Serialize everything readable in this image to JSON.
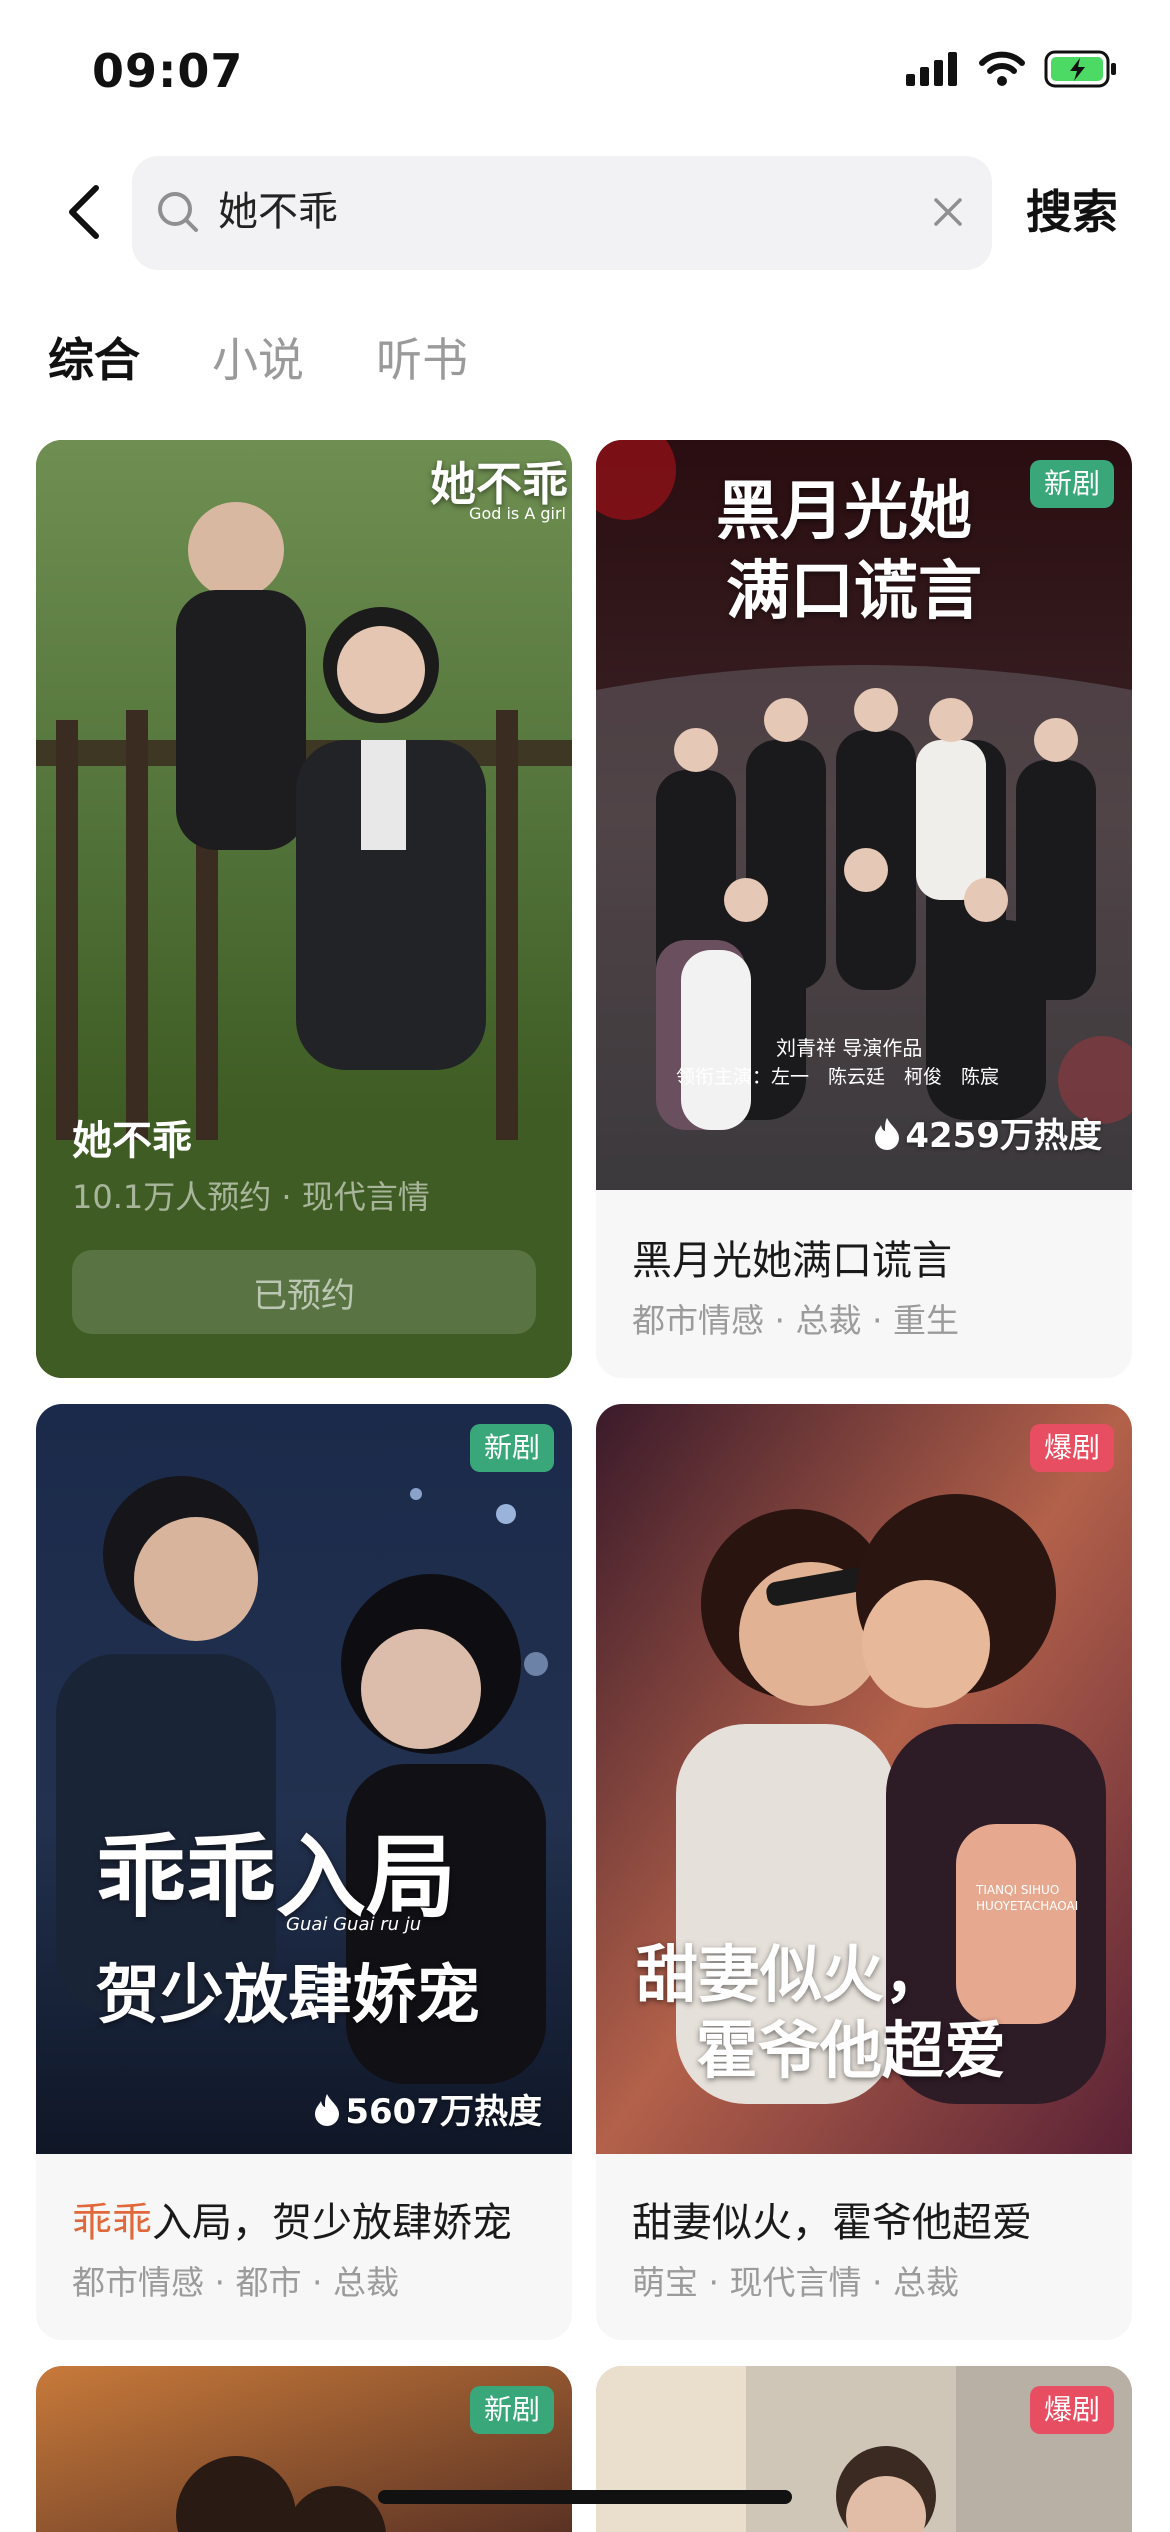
{
  "status_bar": {
    "time": "09:07"
  },
  "search": {
    "query": "她不乖",
    "button_label": "搜索"
  },
  "tabs": [
    {
      "label": "综合",
      "active": true
    },
    {
      "label": "小说",
      "active": false
    },
    {
      "label": "听书",
      "active": false
    }
  ],
  "cards": [
    {
      "poster_logo": "她不乖",
      "poster_subtitle": "God is A girl",
      "title": "她不乖",
      "meta": "10.1万人预约 · 现代言情",
      "reserve_label": "已预约",
      "accent": "#3e5c23"
    },
    {
      "badge": "新剧",
      "poster_title_1": "黑月光她",
      "poster_title_2": "满口谎言",
      "poster_credit_1": "刘青祥 导演作品",
      "poster_credit_2": "领衔主演：左一　陈云廷　柯俊　陈宸",
      "heat": "4259万热度",
      "title": "黑月光她满口谎言",
      "tags": "都市情感 · 总裁 · 重生"
    },
    {
      "badge": "新剧",
      "poster_title_1": "乖乖入局",
      "poster_title_2": "贺少放肆娇宠",
      "poster_romanized": "Guai Guai ru ju",
      "heat": "5607万热度",
      "title_highlight": "乖乖",
      "title_rest": "入局，贺少放肆娇宠",
      "tags": "都市情感 · 都市 · 总裁"
    },
    {
      "badge": "爆剧",
      "poster_title_1": "甜妻似火，",
      "poster_title_2": "霍爷他超爱",
      "poster_romanized": "TIANQI SIHUO HUOYETACHAOAI",
      "title": "甜妻似火，霍爷他超爱",
      "tags": "萌宝 · 现代言情 · 总裁"
    },
    {
      "badge": "新剧"
    },
    {
      "badge": "爆剧"
    }
  ],
  "colors": {
    "new_badge": "#3aa77a",
    "hot_badge": "#e84e62",
    "highlight": "#e0683a"
  }
}
